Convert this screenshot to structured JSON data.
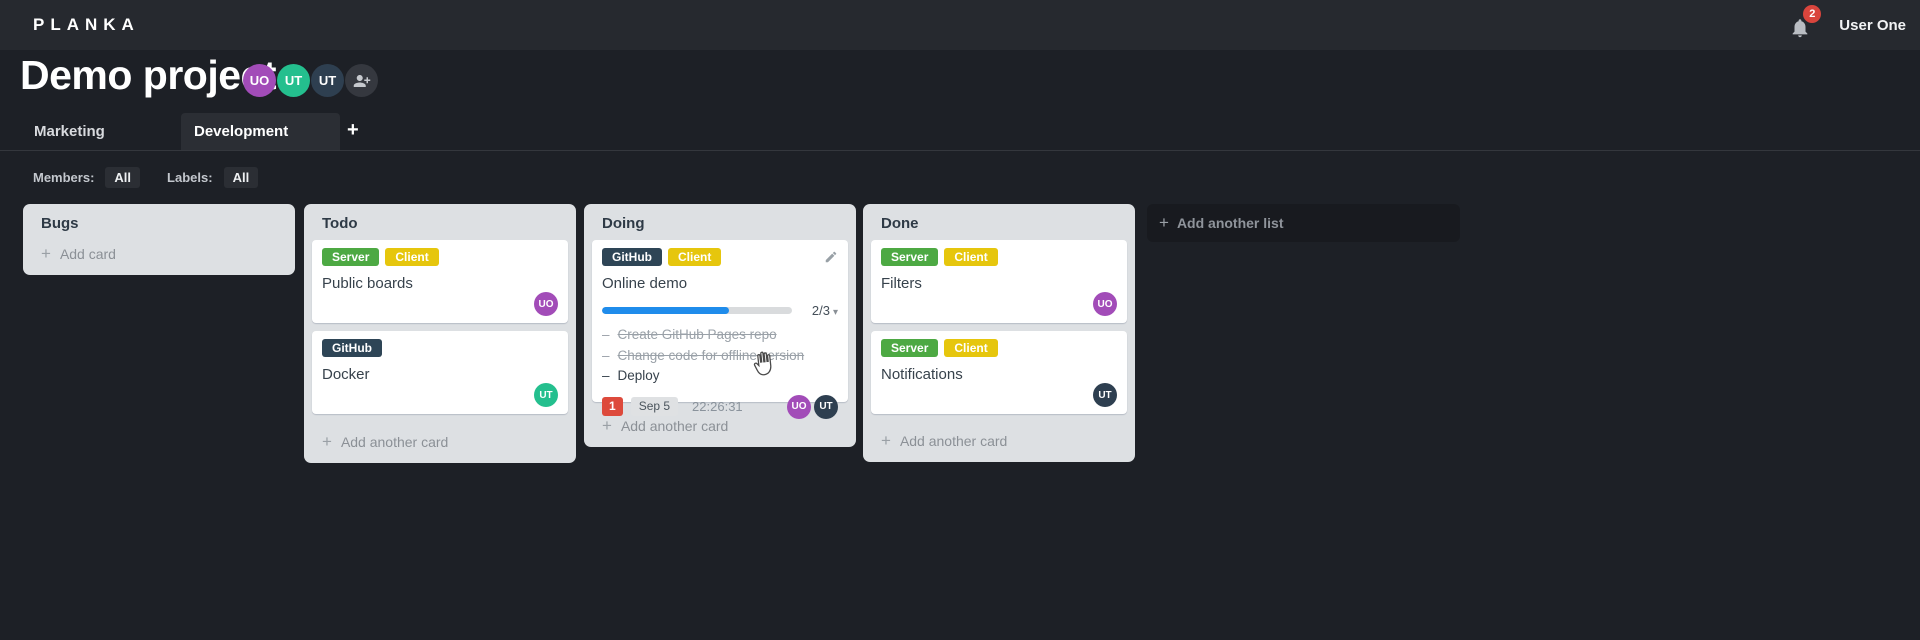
{
  "icons": {
    "plus": "+",
    "chevron_down": "▾",
    "dash": "–"
  },
  "topbar": {
    "logo": "PLANKA",
    "notifications_count": "2",
    "user_name": "User One"
  },
  "project": {
    "title": "Demo project",
    "members": [
      {
        "initials": "UO",
        "color": "#a24cb8"
      },
      {
        "initials": "UT",
        "color": "#24bf8e"
      },
      {
        "initials": "UT",
        "color": "#2e3f50"
      }
    ]
  },
  "tabs": {
    "items": [
      {
        "label": "Marketing"
      },
      {
        "label": "Development"
      }
    ]
  },
  "filters": {
    "members_label": "Members:",
    "members_value": "All",
    "labels_label": "Labels:",
    "labels_value": "All"
  },
  "board": {
    "add_list_label": "Add another list",
    "lists": [
      {
        "title": "Bugs",
        "add_card_label": "Add card",
        "cards": []
      },
      {
        "title": "Todo",
        "add_card_label": "Add another card",
        "cards": [
          {
            "title": "Public boards",
            "labels": [
              {
                "text": "Server",
                "color": "#4da943"
              },
              {
                "text": "Client",
                "color": "#e6c60d"
              }
            ],
            "members": [
              {
                "initials": "UO",
                "color": "#a24cb8"
              }
            ]
          },
          {
            "title": "Docker",
            "labels": [
              {
                "text": "GitHub",
                "color": "#2e4556"
              }
            ],
            "members": [
              {
                "initials": "UT",
                "color": "#24bf8e"
              }
            ]
          }
        ]
      },
      {
        "title": "Doing",
        "add_card_label": "Add another card",
        "cards": [
          {
            "title": "Online demo",
            "labels": [
              {
                "text": "GitHub",
                "color": "#2e4556"
              },
              {
                "text": "Client",
                "color": "#e6c60d"
              }
            ],
            "progress": {
              "label": "2/3",
              "percent": 67,
              "color": "#1f8ceb",
              "done": 2,
              "total": 3
            },
            "tasks": [
              {
                "text": "Create GitHub Pages repo",
                "completed": true
              },
              {
                "text": "Change code for offline version",
                "completed": true
              },
              {
                "text": "Deploy",
                "completed": false
              }
            ],
            "stopwatch": "1",
            "due_date": "Sep 5",
            "timer": "22:26:31",
            "members": [
              {
                "initials": "UO",
                "color": "#a24cb8"
              },
              {
                "initials": "UT",
                "color": "#2e3f50"
              }
            ]
          }
        ]
      },
      {
        "title": "Done",
        "add_card_label": "Add another card",
        "cards": [
          {
            "title": "Filters",
            "labels": [
              {
                "text": "Server",
                "color": "#4da943"
              },
              {
                "text": "Client",
                "color": "#e6c60d"
              }
            ],
            "members": [
              {
                "initials": "UO",
                "color": "#a24cb8"
              }
            ]
          },
          {
            "title": "Notifications",
            "labels": [
              {
                "text": "Server",
                "color": "#4da943"
              },
              {
                "text": "Client",
                "color": "#e6c60d"
              }
            ],
            "members": [
              {
                "initials": "UT",
                "color": "#2e3f50"
              }
            ]
          }
        ]
      }
    ]
  }
}
